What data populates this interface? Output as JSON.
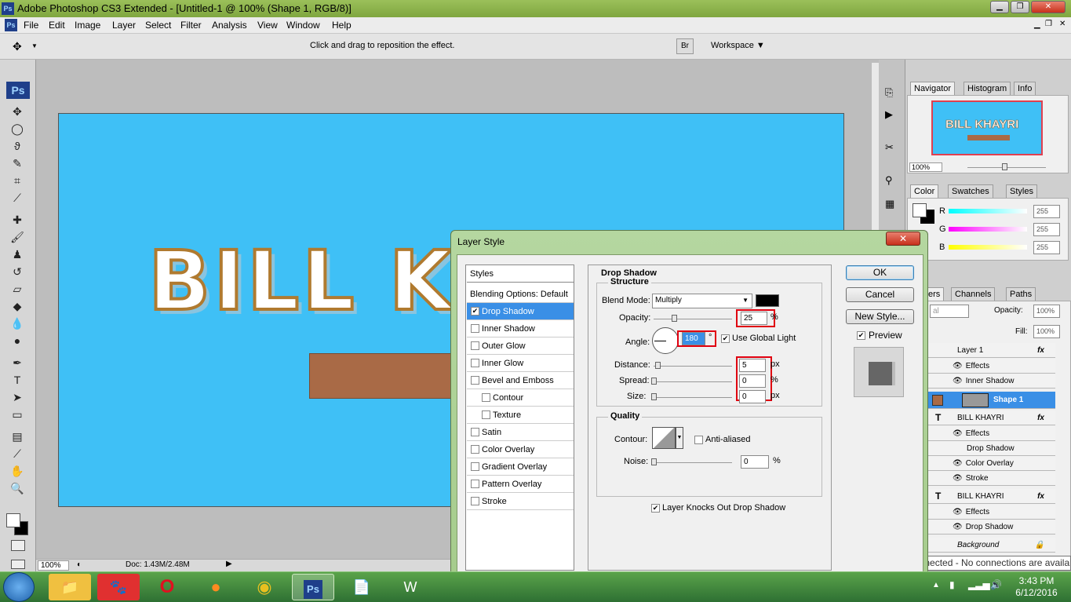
{
  "window": {
    "title": "Adobe Photoshop CS3 Extended - [Untitled-1 @ 100% (Shape 1, RGB/8)]"
  },
  "menu": [
    "File",
    "Edit",
    "Image",
    "Layer",
    "Select",
    "Filter",
    "Analysis",
    "View",
    "Window",
    "Help"
  ],
  "options": {
    "hint": "Click and drag to reposition the effect.",
    "workspace": "Workspace ▼"
  },
  "canvas": {
    "text": "BILL KH",
    "zoom": "100%",
    "doc": "Doc: 1.43M/2.48M"
  },
  "navigator": {
    "tabs": [
      "Navigator",
      "Histogram",
      "Info"
    ],
    "thumb_text": "BILL KHAYRI",
    "zoom": "100%"
  },
  "color_panel": {
    "tabs": [
      "Color",
      "Swatches",
      "Styles"
    ],
    "r": "255",
    "g": "255",
    "b": "255",
    "r_label": "R",
    "g_label": "G",
    "b_label": "B"
  },
  "layers_panel": {
    "tabs": [
      "ers",
      "Channels",
      "Paths"
    ],
    "mode": "al",
    "opacity_label": "Opacity:",
    "opacity": "100%",
    "fill_label": "Fill:",
    "fill": "100%",
    "rows": [
      "Layer 1",
      "Effects",
      "Inner Shadow",
      "Shape 1",
      "BILL KHAYRI",
      "Effects",
      "Drop Shadow",
      "Color Overlay",
      "Stroke",
      "BILL KHAYRI",
      "Effects",
      "Drop Shadow",
      "Background"
    ]
  },
  "dialog": {
    "title": "Layer Style",
    "styles_header": "Styles",
    "styles": [
      "Blending Options: Default",
      "Drop Shadow",
      "Inner Shadow",
      "Outer Glow",
      "Inner Glow",
      "Bevel and Emboss",
      "Contour",
      "Texture",
      "Satin",
      "Color Overlay",
      "Gradient Overlay",
      "Pattern Overlay",
      "Stroke"
    ],
    "section_title": "Drop Shadow",
    "structure": "Structure",
    "blend_mode_label": "Blend Mode:",
    "blend_mode": "Multiply",
    "opacity_label": "Opacity:",
    "opacity": "25",
    "percent": "%",
    "angle_label": "Angle:",
    "angle": "180",
    "deg": "°",
    "global_light": "Use Global Light",
    "distance_label": "Distance:",
    "distance": "5",
    "px": "px",
    "spread_label": "Spread:",
    "spread": "0",
    "size_label": "Size:",
    "size": "0",
    "quality": "Quality",
    "contour_label": "Contour:",
    "anti_aliased": "Anti-aliased",
    "noise_label": "Noise:",
    "noise": "0",
    "knockout": "Layer Knocks Out Drop Shadow",
    "ok": "OK",
    "cancel": "Cancel",
    "new_style": "New Style...",
    "preview": "Preview"
  },
  "tooltip": "Not connected - No connections are available",
  "clock": {
    "time": "3:43 PM",
    "date": "6/12/2016"
  },
  "taskbar": {
    "ps_label": "Ps"
  }
}
